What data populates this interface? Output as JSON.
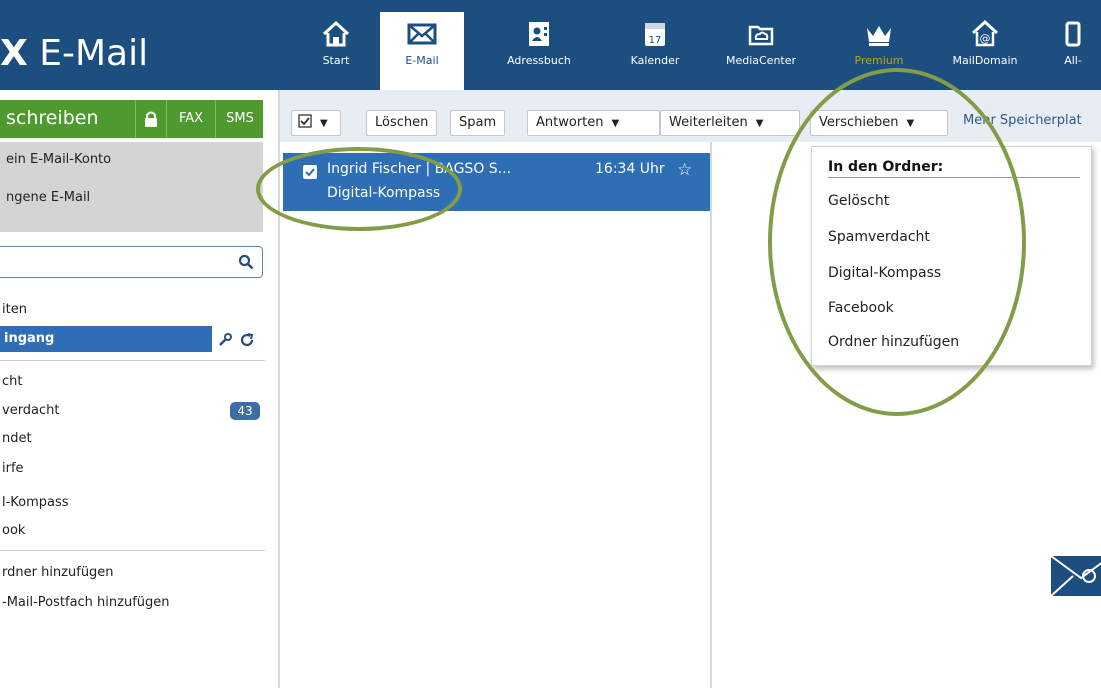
{
  "header": {
    "brand_bold": "X",
    "brand_text": "E-Mail",
    "nav": [
      {
        "label": "Start",
        "icon": "home-icon"
      },
      {
        "label": "E-Mail",
        "icon": "envelope-icon"
      },
      {
        "label": "Adressbuch",
        "icon": "address-book-icon"
      },
      {
        "label": "Kalender",
        "icon": "calendar-icon",
        "day": "17"
      },
      {
        "label": "MediaCenter",
        "icon": "cloud-folder-icon"
      },
      {
        "label": "Premium",
        "icon": "crown-icon"
      },
      {
        "label": "MailDomain",
        "icon": "at-home-icon"
      },
      {
        "label": "All-",
        "icon": "device-icon"
      }
    ]
  },
  "sidebar": {
    "compose_label": "schreiben",
    "fax_label": "FAX",
    "sms_label": "SMS",
    "account_line1": "ein E-Mail-Konto",
    "account_line2": "ngene E-Mail",
    "folders_header": "iten",
    "inbox_label": "ingang",
    "folders": [
      "cht",
      "verdacht",
      "ndet",
      "irfe",
      "l-Kompass",
      "ook"
    ],
    "spam_count": "43",
    "add_folder": "rdner hinzufügen",
    "add_mailbox": "-Mail-Postfach hinzufügen"
  },
  "toolbar": {
    "delete": "Löschen",
    "spam": "Spam",
    "reply": "Antworten",
    "forward": "Weiterleiten",
    "move": "Verschieben",
    "more_storage": "Mehr Speicherplat"
  },
  "message": {
    "sender": "Ingrid Fischer | BAGSO S...",
    "time": "16:34 Uhr",
    "subject": "Digital-Kompass"
  },
  "move_menu": {
    "header": "In den Ordner:",
    "items": [
      "Gelöscht",
      "Spamverdacht",
      "Digital-Kompass",
      "Facebook",
      "Ordner hinzufügen"
    ]
  },
  "colors": {
    "header_bg": "#1c4e80",
    "compose_green": "#4f9a2f",
    "selection_blue": "#2e6eb4",
    "annotation_circle": "#849c48"
  }
}
